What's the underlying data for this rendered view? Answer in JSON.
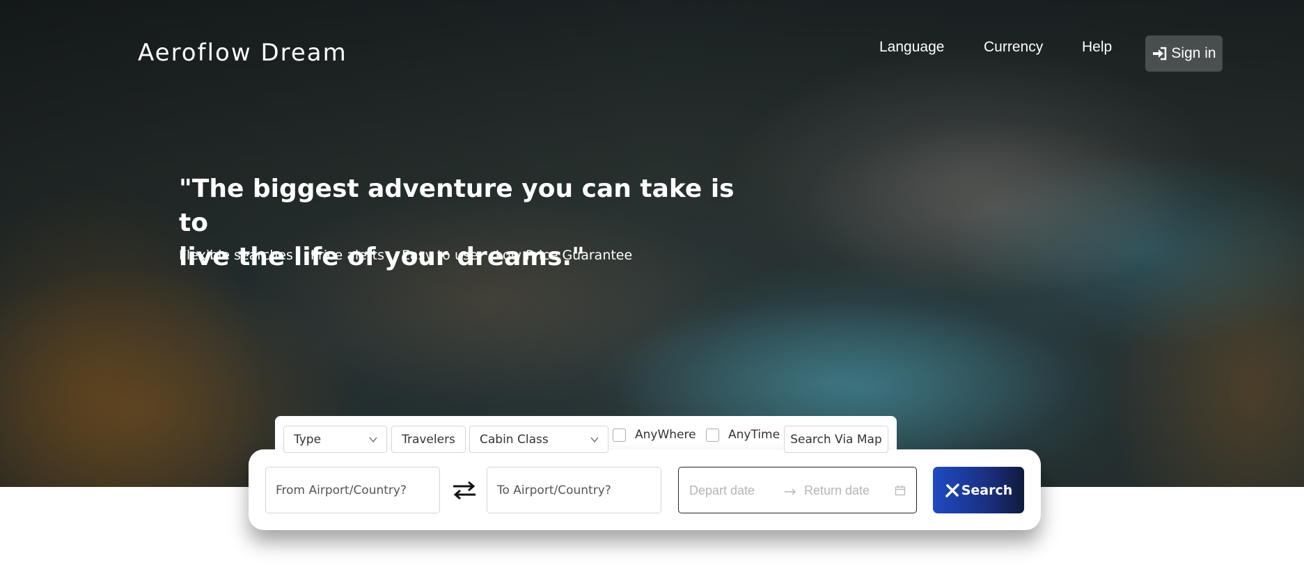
{
  "header": {
    "brand": "Aeroflow Dream",
    "nav": [
      "Language",
      "Currency",
      "Help"
    ],
    "sign_in_label": "Sign in"
  },
  "hero": {
    "quote_line1": "\"The biggest adventure you can take is to",
    "quote_line2": "live the life of your dreams.\"",
    "features": [
      "Flexible searches",
      "Price alerts",
      "Easy to use",
      "Low Price Guarantee"
    ]
  },
  "search_options": {
    "type_label": "Type",
    "travelers_label": "Travelers",
    "cabin_class_label": "Cabin Class",
    "anywhere_label": "AnyWhere",
    "anytime_label": "AnyTime",
    "search_via_map_label": "Search Via Map"
  },
  "search_form": {
    "from_placeholder": "From Airport/Country?",
    "to_placeholder": "To Airport/Country?",
    "depart_placeholder": "Depart date",
    "return_placeholder": "Return date",
    "search_label": "Search"
  },
  "colors": {
    "search_button_start": "#1f4bc3",
    "search_button_end": "#101a3c"
  }
}
